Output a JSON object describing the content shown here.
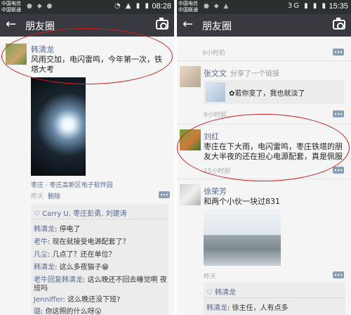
{
  "left": {
    "status": {
      "carrier1": "中国电信",
      "carrier2": "中国联通",
      "clock": "08:28"
    },
    "title": "朋友圈",
    "post1": {
      "author": "韩清龙",
      "text": "风雨交加，电闪雷鸣，今年第一次，铁塔大考",
      "location": "枣庄 · 枣庄高新区电子软件园",
      "time": "昨天",
      "delete": "删除",
      "likes": "Carry U, 枣庄彭勇, 刘建涛",
      "comments": [
        {
          "who": "韩清龙",
          "text": "停电了"
        },
        {
          "who": "老牛",
          "text": "现在就接受电源配套了？"
        },
        {
          "who": "凡尘",
          "text": "几点了？还在单位？"
        },
        {
          "who": "韩清龙",
          "text": "这么多夜猫子😁"
        },
        {
          "who": "老牛回复韩清龙",
          "text": "这么晚还不回去睡觉啊 夜"
        },
        {
          "who": "",
          "text": "班吗"
        },
        {
          "who": "Jenniffer",
          "text": "这么晚还没下班?"
        },
        {
          "who": "璐",
          "text": "你这照的什么呀😮"
        }
      ]
    }
  },
  "right": {
    "status": {
      "carrier1": "中国电信",
      "carrier2": "中国联通",
      "clock": "15:35"
    },
    "title": "朋友圈",
    "top_time": "9小时前",
    "post2": {
      "author": "张文文",
      "action": "分享了一个链接",
      "link_text": "✿若你变了，我也就淡了",
      "time": "9小时前"
    },
    "post3": {
      "author": "刘红",
      "text": "枣庄在下大雨，电闪雷鸣，枣庄铁塔的朋友大半夜的还在担心电源配套，真是佩服",
      "time": "15小时前"
    },
    "post4": {
      "author": "徐荣芳",
      "text": "和两个小伙一块过831",
      "time": "昨天",
      "likes": "韩清龙",
      "comments": [
        {
          "who": "韩清龙",
          "text": "徐主任，人有点多"
        }
      ]
    }
  },
  "icons": {
    "back": "back-arrow-icon",
    "camera": "camera-icon",
    "comment": "comment-icon",
    "heart": "heart-icon"
  },
  "colors": {
    "titlebar": "#393a3f",
    "statusbar": "#2b2f2f",
    "link": "#576b95",
    "highlight_oval": "#d11d1d"
  }
}
